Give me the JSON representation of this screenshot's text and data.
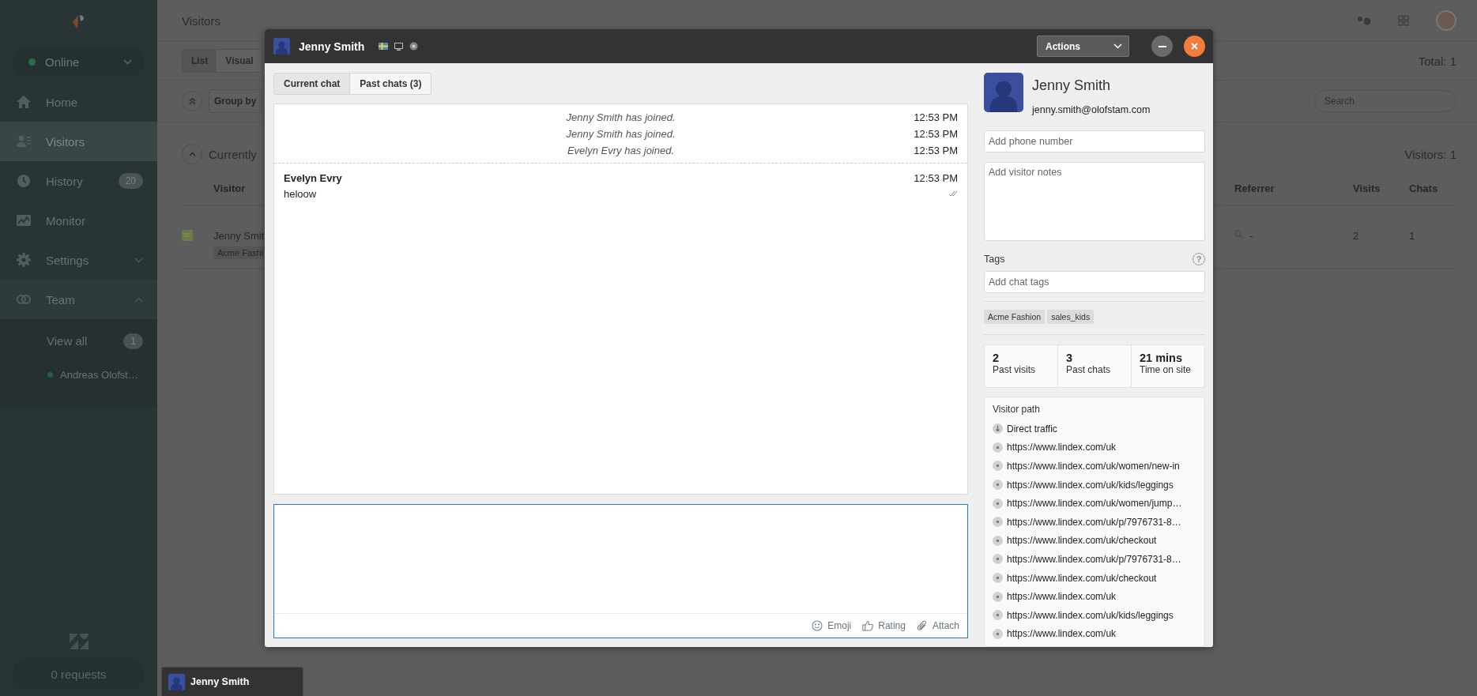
{
  "sidebar": {
    "status": {
      "label": "Online",
      "color": "#2e6b47"
    },
    "items": [
      {
        "label": "Home",
        "selected": false
      },
      {
        "label": "Visitors",
        "selected": true
      },
      {
        "label": "History",
        "selected": false,
        "badge": "20"
      },
      {
        "label": "Monitor",
        "selected": false
      },
      {
        "label": "Settings",
        "selected": false,
        "expanded": false
      },
      {
        "label": "Team",
        "selected": false,
        "expanded": true,
        "children": [
          {
            "label": "View all",
            "badge": "1"
          },
          {
            "label": "Andreas Olofst…",
            "color": "#2b5f41"
          }
        ]
      }
    ],
    "requests": "0 requests"
  },
  "main": {
    "title": "Visitors",
    "view_tabs": [
      {
        "label": "List",
        "selected": true
      },
      {
        "label": "Visual",
        "selected": false
      }
    ],
    "total": "Total: 1",
    "group_by": "Group by",
    "search": {
      "placeholder": "Search"
    },
    "section": {
      "title": "Currently",
      "count": "Visitors: 1"
    },
    "table": {
      "columns": [
        "Visitor",
        "Referrer",
        "Visits",
        "Chats"
      ],
      "rows": [
        {
          "visitor": "Jenny Smit",
          "tag": "Acme Fashi",
          "referrer": "-",
          "visits": "2",
          "chats": "1"
        }
      ]
    }
  },
  "chat_window": {
    "title": "Jenny Smith",
    "actions": "Actions",
    "tabs": [
      {
        "label": "Current chat",
        "selected": true
      },
      {
        "label": "Past chats (3)",
        "selected": false
      }
    ],
    "messages": [
      {
        "kind": "system",
        "text": "Jenny Smith has joined.",
        "time": "12:53 PM"
      },
      {
        "kind": "system",
        "text": "Jenny Smith has joined.",
        "time": "12:53 PM"
      },
      {
        "kind": "system",
        "text": "Evelyn Evry has joined.",
        "time": "12:53 PM"
      },
      {
        "kind": "message",
        "sender": "Evelyn Evry",
        "time": "12:53 PM",
        "text": "heloow",
        "read": true
      }
    ],
    "composer": {
      "tools": [
        "Emoji",
        "Rating",
        "Attach"
      ]
    },
    "visitor": {
      "name": "Jenny Smith",
      "email": "jenny.smith@olofstam.com",
      "phone": {
        "placeholder": "Add phone number"
      },
      "notes": {
        "placeholder": "Add visitor notes"
      },
      "tags_label": "Tags",
      "tags_help": "?",
      "tags_field": {
        "placeholder": "Add chat tags"
      },
      "tags": [
        "Acme Fashion",
        "sales_kids"
      ],
      "stats": [
        {
          "value": "2",
          "label": "Past visits"
        },
        {
          "value": "3",
          "label": "Past chats"
        },
        {
          "value": "21 mins",
          "label": "Time on site"
        }
      ],
      "path": {
        "title": "Visitor path",
        "items": [
          {
            "kind": "source",
            "text": "Direct traffic"
          },
          {
            "kind": "page",
            "text": "https://www.lindex.com/uk"
          },
          {
            "kind": "page",
            "text": "https://www.lindex.com/uk/women/new-in"
          },
          {
            "kind": "page",
            "text": "https://www.lindex.com/uk/kids/leggings"
          },
          {
            "kind": "page",
            "text": "https://www.lindex.com/uk/women/jump…"
          },
          {
            "kind": "page",
            "text": "https://www.lindex.com/uk/p/7976731-8…"
          },
          {
            "kind": "page",
            "text": "https://www.lindex.com/uk/checkout"
          },
          {
            "kind": "page",
            "text": "https://www.lindex.com/uk/p/7976731-8…"
          },
          {
            "kind": "page",
            "text": "https://www.lindex.com/uk/checkout"
          },
          {
            "kind": "page",
            "text": "https://www.lindex.com/uk"
          },
          {
            "kind": "page",
            "text": "https://www.lindex.com/uk/kids/leggings"
          },
          {
            "kind": "page",
            "text": "https://www.lindex.com/uk"
          }
        ]
      }
    }
  },
  "taskbar": [
    {
      "label": "Jenny Smith",
      "selected": true
    }
  ]
}
